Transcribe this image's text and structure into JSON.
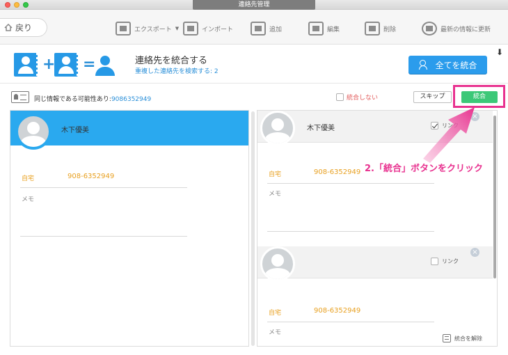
{
  "window": {
    "title": "連絡先管理"
  },
  "toolbar": {
    "back_label": "戻り",
    "export_label": "エクスポート",
    "import_label": "インポート",
    "add_label": "追加",
    "edit_label": "編集",
    "delete_label": "削除",
    "refresh_label": "最新の情報に更新"
  },
  "merge_header": {
    "title": "連絡先を統合する",
    "subtitle_prefix": "重複した連絡先を検索する: ",
    "duplicate_count": "2",
    "merge_all_label": "全てを統合",
    "plus": "+",
    "equals": "=",
    "download_glyph": "⬇"
  },
  "info_row": {
    "possible_dup_text": "同じ情報である可能性あり:",
    "phone": "9086352949",
    "no_merge_label": "統合しない",
    "skip_label": "スキップ",
    "merge_label": "統合"
  },
  "left_panel": {
    "name": "木下優美",
    "home_label": "自宅",
    "home_value": "908-6352949",
    "memo_label": "メモ"
  },
  "right_panel": {
    "cards": [
      {
        "name": "木下優美",
        "link_label": "リンク",
        "home_label": "自宅",
        "home_value": "908-6352949",
        "memo_label": "メモ",
        "link_checked": true
      },
      {
        "name": "",
        "link_label": "リンク",
        "home_label": "自宅",
        "home_value": "908-6352949",
        "memo_label": "メモ",
        "link_checked": false
      }
    ]
  },
  "annotation": {
    "text": "2.「統合」ボタンをクリック",
    "color": "#e8318f"
  },
  "footer": {
    "unmerge_label": "統合を解除"
  },
  "colors": {
    "accent": "#2aa9ef",
    "merge_green": "#3cc878",
    "field_orange": "#e8a020",
    "highlight_pink": "#e8318f"
  }
}
